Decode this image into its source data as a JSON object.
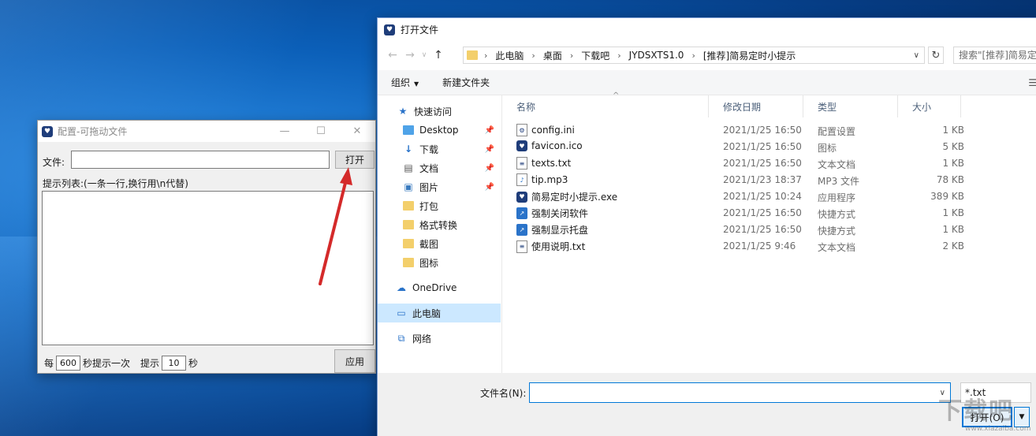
{
  "config_window": {
    "title": "配置-可拖动文件",
    "file_label": "文件:",
    "file_value": "",
    "open_button": "打开",
    "hint_label": "提示列表:(一条一行,换行用\\n代替)",
    "every_label": "每",
    "interval_value": "600",
    "interval_suffix": "秒提示一次",
    "remind_label": "提示",
    "duration_value": "10",
    "duration_suffix": "秒",
    "apply_button": "应用",
    "title_controls": [
      "—",
      "☐",
      "✕"
    ]
  },
  "dialog": {
    "title": "打开文件",
    "breadcrumbs": [
      "此电脑",
      "桌面",
      "下载吧",
      "JYDSXTS1.0",
      "[推荐]简易定时小提示"
    ],
    "search_placeholder": "搜索\"[推荐]简易定时小提示\"",
    "toolbar": {
      "organize": "组织",
      "new_folder": "新建文件夹"
    },
    "nav": [
      {
        "label": "快速访问",
        "icon": "star-icon"
      },
      {
        "label": "Desktop",
        "icon": "folder-icon",
        "pinned": true
      },
      {
        "label": "下载",
        "icon": "download-icon",
        "pinned": true
      },
      {
        "label": "文档",
        "icon": "document-icon",
        "pinned": true
      },
      {
        "label": "图片",
        "icon": "picture-icon",
        "pinned": true
      },
      {
        "label": "打包",
        "icon": "folder-icon"
      },
      {
        "label": "格式转换",
        "icon": "folder-icon"
      },
      {
        "label": "截图",
        "icon": "folder-icon"
      },
      {
        "label": "图标",
        "icon": "folder-icon"
      },
      {
        "label": "OneDrive",
        "icon": "cloud-icon"
      },
      {
        "label": "此电脑",
        "icon": "computer-icon",
        "selected": true
      },
      {
        "label": "网络",
        "icon": "network-icon"
      }
    ],
    "columns": [
      "名称",
      "修改日期",
      "类型",
      "大小"
    ],
    "files": [
      {
        "name": "config.ini",
        "date": "2021/1/25 16:50",
        "type": "配置设置",
        "size": "1 KB",
        "icon": "settings-file-icon"
      },
      {
        "name": "favicon.ico",
        "date": "2021/1/25 16:50",
        "type": "图标",
        "size": "5 KB",
        "icon": "app-icon"
      },
      {
        "name": "texts.txt",
        "date": "2021/1/25 16:50",
        "type": "文本文档",
        "size": "1 KB",
        "icon": "text-file-icon"
      },
      {
        "name": "tip.mp3",
        "date": "2021/1/23 18:37",
        "type": "MP3 文件",
        "size": "78 KB",
        "icon": "audio-file-icon"
      },
      {
        "name": "简易定时小提示.exe",
        "date": "2021/1/25 10:24",
        "type": "应用程序",
        "size": "389 KB",
        "icon": "app-icon"
      },
      {
        "name": "强制关闭软件",
        "date": "2021/1/25 16:50",
        "type": "快捷方式",
        "size": "1 KB",
        "icon": "shortcut-icon"
      },
      {
        "name": "强制显示托盘",
        "date": "2021/1/25 16:50",
        "type": "快捷方式",
        "size": "1 KB",
        "icon": "shortcut-icon"
      },
      {
        "name": "使用说明.txt",
        "date": "2021/1/25 9:46",
        "type": "文本文档",
        "size": "2 KB",
        "icon": "text-file-icon"
      }
    ],
    "filename_label": "文件名(N):",
    "filename_value": "",
    "filter_value": "*.txt",
    "open_button": "打开(O)"
  },
  "colors": {
    "accent": "#0078d7",
    "selection": "#cce8ff",
    "annotation_arrow": "#d42a2a"
  }
}
